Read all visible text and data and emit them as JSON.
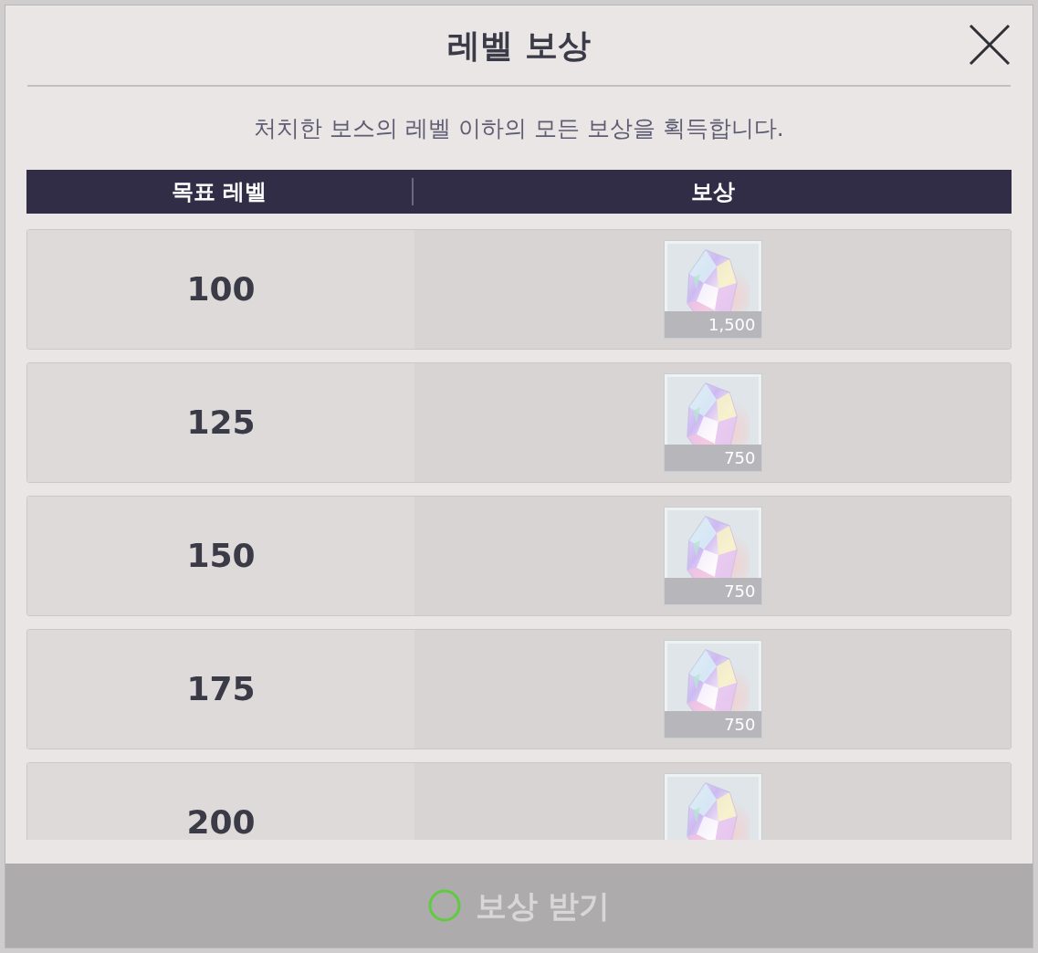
{
  "dialog": {
    "title": "레벨 보상",
    "description": "처치한 보스의 레벨 이하의 모든 보상을 획득합니다."
  },
  "table": {
    "columns": [
      "목표 레벨",
      "보상"
    ],
    "rows": [
      {
        "target_level": "100",
        "reward": {
          "kind": "crystal",
          "quantity": "1,500"
        }
      },
      {
        "target_level": "125",
        "reward": {
          "kind": "crystal",
          "quantity": "750"
        }
      },
      {
        "target_level": "150",
        "reward": {
          "kind": "crystal",
          "quantity": "750"
        }
      },
      {
        "target_level": "175",
        "reward": {
          "kind": "crystal",
          "quantity": "750"
        }
      },
      {
        "target_level": "200",
        "reward": {
          "kind": "crystal"
        }
      }
    ]
  },
  "claim_button": {
    "label": "보상 받기",
    "disabled": true
  }
}
